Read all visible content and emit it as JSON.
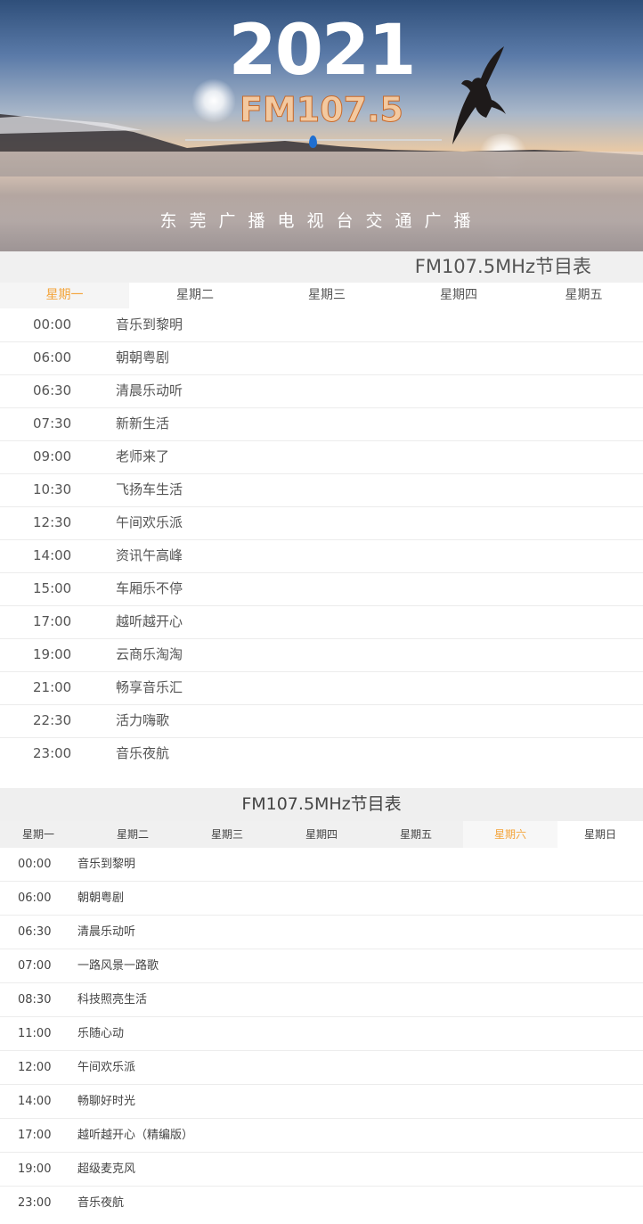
{
  "banner": {
    "year": "2021",
    "fm_logo": "FM107.5",
    "subtitle": "东莞广播电视台交通广播"
  },
  "schedule1": {
    "title": "FM107.5MHz节目表",
    "tabs": [
      "星期一",
      "星期二",
      "星期三",
      "星期四",
      "星期五"
    ],
    "active_tab": "星期一",
    "rows": [
      {
        "time": "00:00",
        "program": "音乐到黎明"
      },
      {
        "time": "06:00",
        "program": "朝朝粤剧"
      },
      {
        "time": "06:30",
        "program": "清晨乐动听"
      },
      {
        "time": "07:30",
        "program": "新新生活"
      },
      {
        "time": "09:00",
        "program": "老师来了"
      },
      {
        "time": "10:30",
        "program": "飞扬车生活"
      },
      {
        "time": "12:30",
        "program": "午间欢乐派"
      },
      {
        "time": "14:00",
        "program": "资讯午高峰"
      },
      {
        "time": "15:00",
        "program": "车厢乐不停"
      },
      {
        "time": "17:00",
        "program": "越听越开心"
      },
      {
        "time": "19:00",
        "program": "云商乐淘淘"
      },
      {
        "time": "21:00",
        "program": "畅享音乐汇"
      },
      {
        "time": "22:30",
        "program": "活力嗨歌"
      },
      {
        "time": "23:00",
        "program": "音乐夜航"
      }
    ]
  },
  "schedule2": {
    "title": "FM107.5MHz节目表",
    "tabs": [
      "星期一",
      "星期二",
      "星期三",
      "星期四",
      "星期五",
      "星期六",
      "星期日"
    ],
    "active_tab": "星期六",
    "rows": [
      {
        "time": "00:00",
        "program": "音乐到黎明"
      },
      {
        "time": "06:00",
        "program": "朝朝粤剧"
      },
      {
        "time": "06:30",
        "program": "清晨乐动听"
      },
      {
        "time": "07:00",
        "program": "一路风景一路歌"
      },
      {
        "time": "08:30",
        "program": "科技照亮生活"
      },
      {
        "time": "11:00",
        "program": "乐随心动"
      },
      {
        "time": "12:00",
        "program": "午间欢乐派"
      },
      {
        "time": "14:00",
        "program": "畅聊好时光"
      },
      {
        "time": "17:00",
        "program": "越听越开心（精编版）"
      },
      {
        "time": "19:00",
        "program": "超级麦克风"
      },
      {
        "time": "23:00",
        "program": "音乐夜航"
      }
    ]
  },
  "colors": {
    "accent": "#f4a43a",
    "text": "#555555",
    "header_bg": "#f0f0f0"
  }
}
